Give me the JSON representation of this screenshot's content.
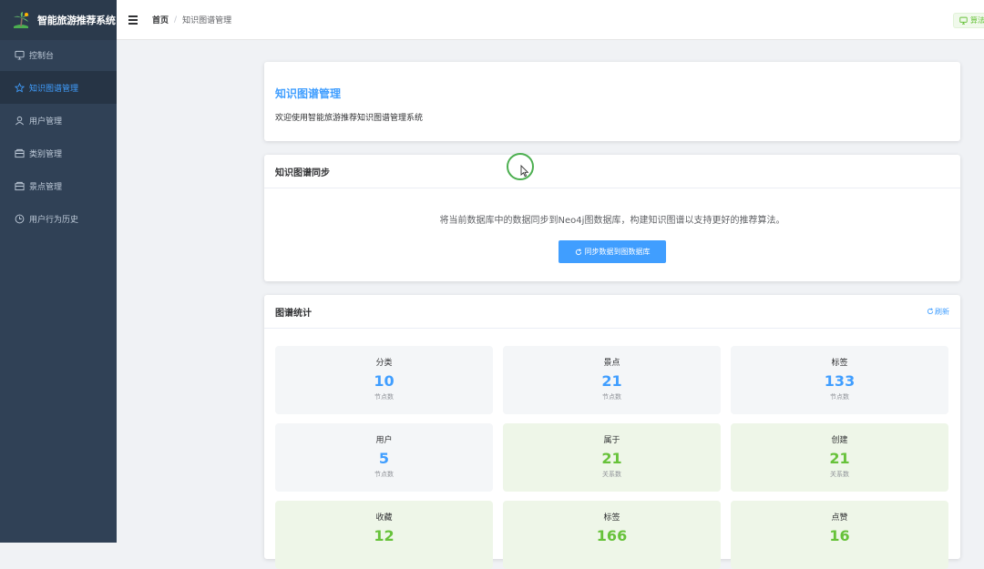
{
  "app": {
    "title": "智能旅游推荐系统"
  },
  "sidebar": {
    "items": [
      {
        "label": "控制台",
        "icon": "monitor-icon"
      },
      {
        "label": "知识图谱管理",
        "icon": "star-icon",
        "active": true
      },
      {
        "label": "用户管理",
        "icon": "user-icon"
      },
      {
        "label": "类别管理",
        "icon": "folder-icon"
      },
      {
        "label": "景点管理",
        "icon": "folder-icon"
      },
      {
        "label": "用户行为历史",
        "icon": "clock-icon"
      }
    ]
  },
  "header": {
    "breadcrumb_home": "首页",
    "breadcrumb_sep": "/",
    "breadcrumb_current": "知识图谱管理",
    "right_tag": "算法"
  },
  "welcome": {
    "title": "知识图谱管理",
    "desc": "欢迎使用智能旅游推荐知识图谱管理系统"
  },
  "sync": {
    "title": "知识图谱同步",
    "desc": "将当前数据库中的数据同步到Neo4j图数据库，构建知识图谱以支持更好的推荐算法。",
    "button": "同步数据到图数据库"
  },
  "stats": {
    "title": "图谱统计",
    "refresh": "刷新",
    "items": [
      {
        "name": "分类",
        "value": "10",
        "sub": "节点数",
        "kind": "node"
      },
      {
        "name": "景点",
        "value": "21",
        "sub": "节点数",
        "kind": "node"
      },
      {
        "name": "标签",
        "value": "133",
        "sub": "节点数",
        "kind": "node"
      },
      {
        "name": "用户",
        "value": "5",
        "sub": "节点数",
        "kind": "node"
      },
      {
        "name": "属于",
        "value": "21",
        "sub": "关系数",
        "kind": "rel"
      },
      {
        "name": "创建",
        "value": "21",
        "sub": "关系数",
        "kind": "rel"
      },
      {
        "name": "收藏",
        "value": "12",
        "sub": "",
        "kind": "rel"
      },
      {
        "name": "标签",
        "value": "166",
        "sub": "",
        "kind": "rel"
      },
      {
        "name": "点赞",
        "value": "16",
        "sub": "",
        "kind": "rel"
      }
    ]
  },
  "colors": {
    "sidebar_bg": "#304156",
    "accent": "#409eff",
    "success": "#67c23a"
  }
}
